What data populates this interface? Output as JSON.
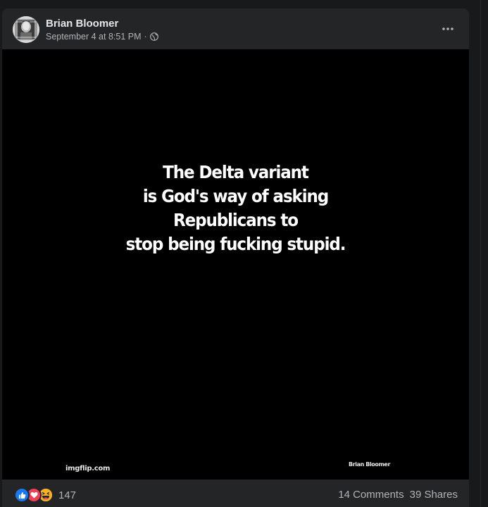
{
  "post": {
    "author": "Brian Bloomer",
    "timestamp": "September 4 at 8:51 PM",
    "separator": "·",
    "privacy_icon": "globe-icon",
    "menu_icon": "more-options-icon"
  },
  "image": {
    "meme_lines": [
      "The Delta variant",
      "is God's way of asking",
      "Republicans to",
      "stop being fucking stupid."
    ],
    "watermark_left": "imgflip.com",
    "watermark_right": "Brian Bloomer"
  },
  "footer": {
    "reaction_icons": [
      "like-icon",
      "love-icon",
      "haha-icon"
    ],
    "reaction_count": "147",
    "comments": "14 Comments",
    "shares": "39 Shares"
  },
  "colors": {
    "page_bg": "#18191a",
    "card_bg": "#242526",
    "primary_text": "#e4e6eb",
    "secondary_text": "#b0b3b8",
    "like": "#1877f2",
    "love": "#f33e58",
    "haha": "#f7b125"
  }
}
